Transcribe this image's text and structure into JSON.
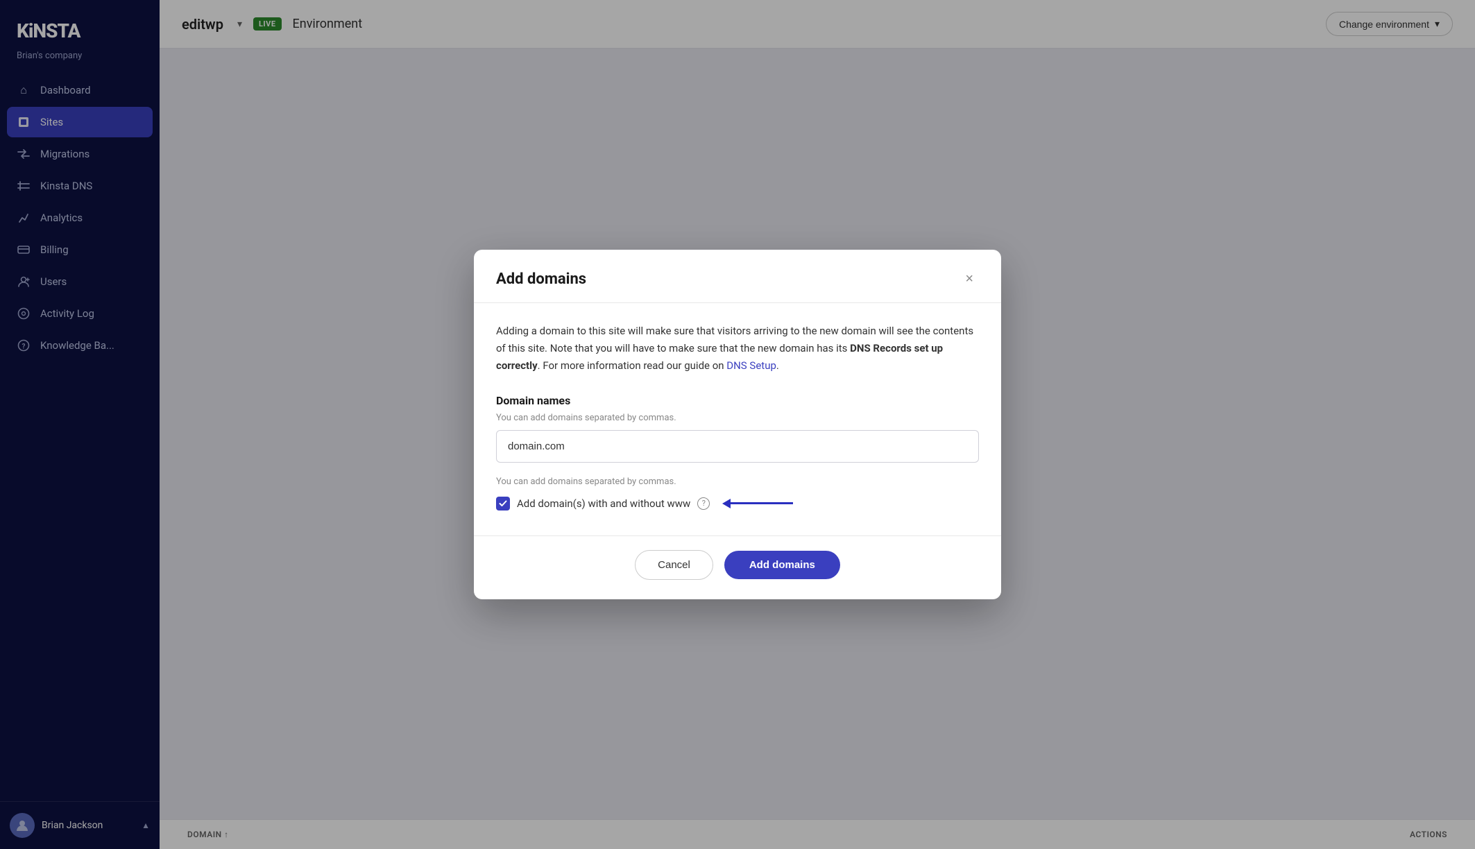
{
  "sidebar": {
    "logo": "KiNSTA",
    "company": "Brian's company",
    "items": [
      {
        "id": "dashboard",
        "label": "Dashboard",
        "icon": "⌂",
        "active": false
      },
      {
        "id": "sites",
        "label": "Sites",
        "icon": "◈",
        "active": true
      },
      {
        "id": "migrations",
        "label": "Migrations",
        "icon": "⇝",
        "active": false
      },
      {
        "id": "kinsta-dns",
        "label": "Kinsta DNS",
        "icon": "⇄",
        "active": false
      },
      {
        "id": "analytics",
        "label": "Analytics",
        "icon": "↗",
        "active": false
      },
      {
        "id": "billing",
        "label": "Billing",
        "icon": "▤",
        "active": false
      },
      {
        "id": "users",
        "label": "Users",
        "icon": "⊕",
        "active": false
      },
      {
        "id": "activity-log",
        "label": "Activity Log",
        "icon": "◎",
        "active": false
      },
      {
        "id": "knowledge-base",
        "label": "Knowledge Ba...",
        "icon": "?",
        "active": false
      }
    ],
    "user": {
      "name": "Brian Jackson",
      "avatar": "👤"
    }
  },
  "topbar": {
    "site_name": "editwp",
    "env_badge": "LIVE",
    "env_label": "Environment",
    "change_env_label": "Change environment"
  },
  "table": {
    "col_domain": "DOMAIN ↑",
    "col_actions": "ACTIONS"
  },
  "modal": {
    "title": "Add domains",
    "description_part1": "Adding a domain to this site will make sure that visitors arriving to the new domain will see the contents of this site. Note that you will have to make sure that the new domain has its ",
    "description_bold": "DNS Records set up correctly",
    "description_part2": ". For more information read our guide on ",
    "dns_link": "DNS Setup",
    "dns_link_suffix": ".",
    "domain_names_label": "Domain names",
    "input_hint": "You can add domains separated by commas.",
    "input_value": "domain.com",
    "input_hint_2": "You can add domains separated by commas.",
    "checkbox_label": "Add domain(s) with and without www",
    "cancel_label": "Cancel",
    "add_domains_label": "Add domains",
    "close_label": "×"
  }
}
